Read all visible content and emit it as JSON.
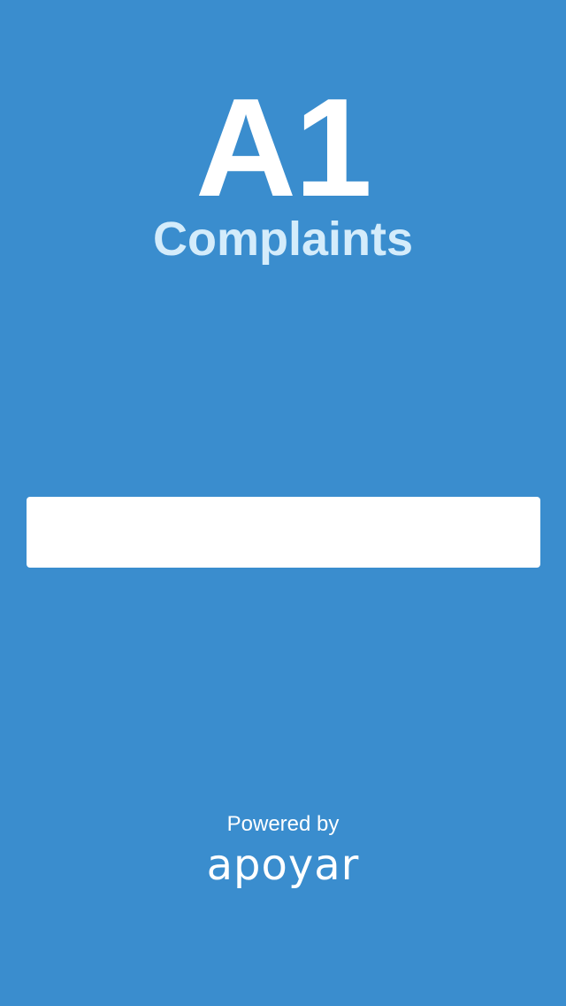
{
  "app": {
    "title": "A1",
    "subtitle": "Complaints"
  },
  "form": {
    "field_value": "",
    "field_placeholder": ""
  },
  "footer": {
    "powered_by": "Powered by",
    "vendor_name": "apoyar"
  },
  "colors": {
    "background": "#3a8dce",
    "title": "#ffffff",
    "subtitle": "#d4ecfb",
    "field": "#ffffff"
  }
}
